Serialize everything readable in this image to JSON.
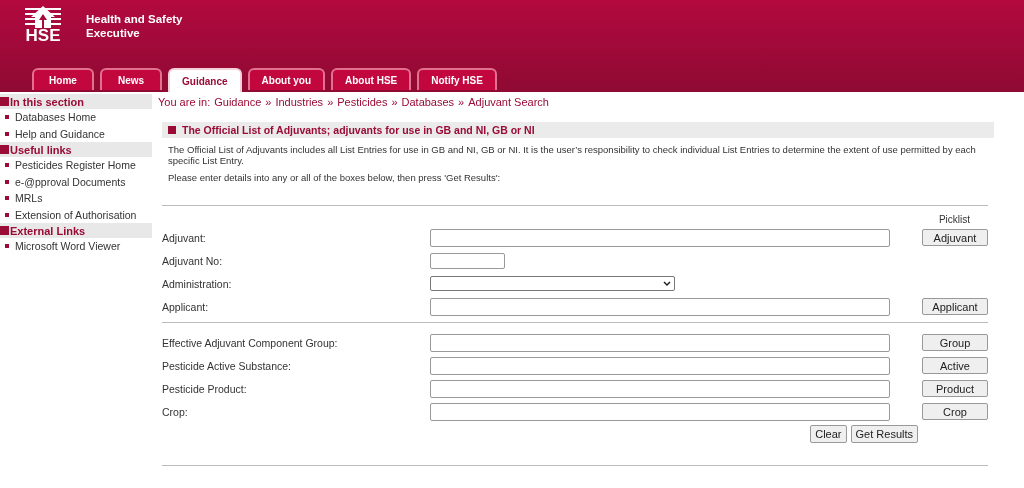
{
  "header": {
    "logo_text": "HSE",
    "title_lines": [
      "Health and Safety",
      "Executive"
    ]
  },
  "tabs": [
    {
      "label": "Home",
      "selected": false
    },
    {
      "label": "News",
      "selected": false
    },
    {
      "label": "Guidance",
      "selected": true
    },
    {
      "label": "About you",
      "selected": false
    },
    {
      "label": "About HSE",
      "selected": false
    },
    {
      "label": "Notify HSE",
      "selected": false
    }
  ],
  "sidebar": {
    "sections": [
      {
        "heading": "In this section",
        "items": [
          "Databases Home",
          "Help and Guidance"
        ]
      },
      {
        "heading": "Useful links",
        "items": [
          "Pesticides Register Home",
          "e-@pproval Documents",
          "MRLs",
          "Extension of Authorisation"
        ]
      },
      {
        "heading": "External Links",
        "items": [
          "Microsoft Word Viewer"
        ]
      }
    ]
  },
  "breadcrumb": {
    "prefix": "You are in:",
    "separator": "»",
    "items": [
      "Guidance",
      "Industries",
      "Pesticides",
      "Databases",
      "Adjuvant Search"
    ]
  },
  "heading": "The Official List of Adjuvants; adjuvants for use in GB and NI, GB or NI",
  "intro": "The Official List of Adjuvants includes all List Entries for use in GB and NI, GB or NI. It is the user’s responsibility to check individual List Entries to determine the extent of use permitted by each specific List Entry.",
  "instruction": "Please enter details into any or all of the boxes below, then press 'Get Results':",
  "picklist_heading": "Picklist",
  "field_groups": [
    [
      {
        "label": "Adjuvant:",
        "kind": "text",
        "button": "Adjuvant"
      },
      {
        "label": "Adjuvant No:",
        "kind": "short"
      },
      {
        "label": "Administration:",
        "kind": "select"
      },
      {
        "label": "Applicant:",
        "kind": "text",
        "button": "Applicant"
      }
    ],
    [
      {
        "label": "Effective Adjuvant Component Group:",
        "kind": "text",
        "button": "Group"
      },
      {
        "label": "Pesticide Active Substance:",
        "kind": "text",
        "button": "Active"
      },
      {
        "label": "Pesticide Product:",
        "kind": "text",
        "button": "Product"
      },
      {
        "label": "Crop:",
        "kind": "text",
        "button": "Crop"
      }
    ]
  ],
  "actions": [
    "Clear",
    "Get Results"
  ]
}
